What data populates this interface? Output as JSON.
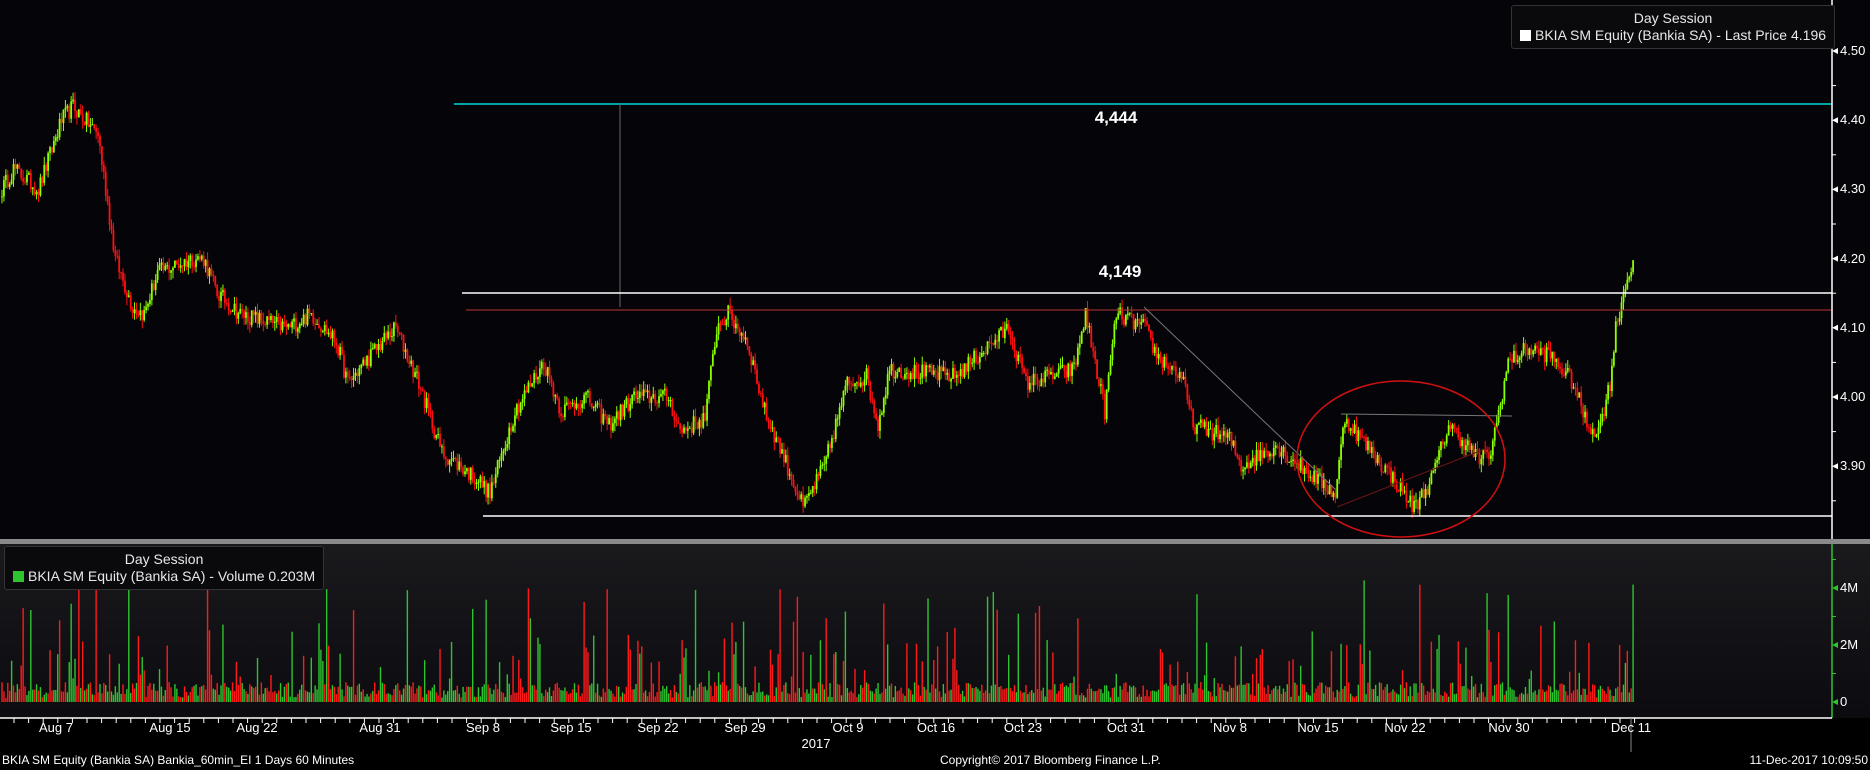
{
  "chart_data": {
    "type": "candlestick",
    "ticker": "BKIA SM Equity (Bankia SA)",
    "interval": "60 Minutes",
    "price_legend": {
      "title": "Day Session",
      "label": "BKIA SM Equity (Bankia SA) - Last Price 4.196",
      "color": "#ffffff"
    },
    "volume_legend": {
      "title": "Day Session",
      "label": "BKIA SM Equity (Bankia SA) - Volume 0.203M",
      "color": "#2fc42f"
    },
    "price_axis": {
      "ticks": [
        "4.50",
        "4.40",
        "4.30",
        "4.20",
        "4.10",
        "4.00",
        "3.90"
      ],
      "ylim": [
        3.795,
        4.566
      ]
    },
    "volume_axis": {
      "ticks": [
        "4M",
        "2M",
        "0"
      ],
      "ylim": [
        0,
        5.5
      ]
    },
    "x_ticks": [
      "Aug 7",
      "Aug 15",
      "Aug 22",
      "Aug 31",
      "Sep 8",
      "Sep 15",
      "Sep 22",
      "Sep 29",
      "Oct 9",
      "Oct 16",
      "Oct 23",
      "Oct 31",
      "Nov 8",
      "Nov 15",
      "Nov 22",
      "Nov 30",
      "Dec 11"
    ],
    "year_label": "2017",
    "annotations": {
      "upper_level": "4,444",
      "resistance_level": "4,149"
    },
    "total_bars": 850,
    "price_path": [
      [
        0,
        4.3
      ],
      [
        6,
        4.33
      ],
      [
        19,
        4.3
      ],
      [
        31,
        4.4
      ],
      [
        37,
        4.42
      ],
      [
        50,
        4.38
      ],
      [
        53,
        4.32
      ],
      [
        59,
        4.2
      ],
      [
        68,
        4.13
      ],
      [
        74,
        4.12
      ],
      [
        81,
        4.18
      ],
      [
        99,
        4.2
      ],
      [
        105,
        4.2
      ],
      [
        112,
        4.15
      ],
      [
        124,
        4.12
      ],
      [
        149,
        4.1
      ],
      [
        161,
        4.12
      ],
      [
        174,
        4.08
      ],
      [
        180,
        4.02
      ],
      [
        198,
        4.08
      ],
      [
        205,
        4.1
      ],
      [
        217,
        4.02
      ],
      [
        229,
        3.92
      ],
      [
        248,
        3.88
      ],
      [
        254,
        3.86
      ],
      [
        267,
        3.98
      ],
      [
        282,
        4.05
      ],
      [
        291,
        3.98
      ],
      [
        304,
        4.0
      ],
      [
        316,
        3.96
      ],
      [
        329,
        4.0
      ],
      [
        347,
        4.0
      ],
      [
        353,
        3.95
      ],
      [
        366,
        3.97
      ],
      [
        372,
        4.1
      ],
      [
        378,
        4.12
      ],
      [
        388,
        4.08
      ],
      [
        397,
        3.98
      ],
      [
        406,
        3.92
      ],
      [
        417,
        3.84
      ],
      [
        428,
        3.9
      ],
      [
        440,
        4.02
      ],
      [
        450,
        4.03
      ],
      [
        456,
        3.96
      ],
      [
        462,
        4.04
      ],
      [
        496,
        4.03
      ],
      [
        508,
        4.06
      ],
      [
        524,
        4.1
      ],
      [
        533,
        4.02
      ],
      [
        558,
        4.04
      ],
      [
        564,
        4.12
      ],
      [
        574,
        3.98
      ],
      [
        580,
        4.12
      ],
      [
        595,
        4.1
      ],
      [
        601,
        4.06
      ],
      [
        614,
        4.03
      ],
      [
        620,
        3.96
      ],
      [
        639,
        3.94
      ],
      [
        645,
        3.9
      ],
      [
        663,
        3.93
      ],
      [
        676,
        3.9
      ],
      [
        694,
        3.86
      ],
      [
        699,
        3.97
      ],
      [
        713,
        3.92
      ],
      [
        725,
        3.88
      ],
      [
        735,
        3.84
      ],
      [
        744,
        3.88
      ],
      [
        753,
        3.96
      ],
      [
        769,
        3.91
      ],
      [
        775,
        3.92
      ],
      [
        784,
        4.05
      ],
      [
        794,
        4.07
      ],
      [
        806,
        4.06
      ],
      [
        818,
        4.02
      ],
      [
        825,
        3.96
      ],
      [
        831,
        3.95
      ],
      [
        837,
        4.02
      ],
      [
        840,
        4.1
      ],
      [
        844,
        4.15
      ],
      [
        849,
        4.2
      ]
    ],
    "colors": {
      "up": "#8cff00",
      "down": "#ff1010",
      "vol_up": "#2fc42f",
      "vol_down": "#ff1a1a",
      "level": "#00d8d8"
    }
  },
  "footer": {
    "left": "BKIA SM Equity (Bankia SA) Bankia_60min_EI 1 Days 60 Minutes",
    "center": "Copyright© 2017 Bloomberg Finance L.P.",
    "right": "11-Dec-2017 10:09:50"
  }
}
